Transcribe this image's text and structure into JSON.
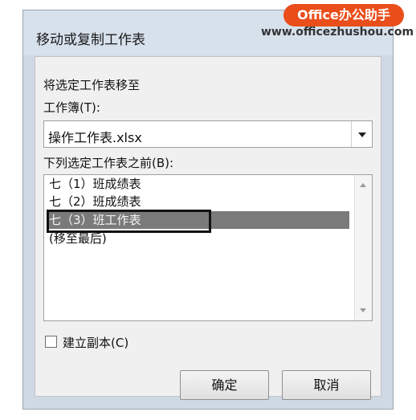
{
  "dialog": {
    "title": "移动或复制工作表",
    "move_to_label": "将选定工作表移至",
    "workbook_label": "工作簿(T):",
    "workbook_value": "操作工作表.xlsx",
    "before_sheet_label": "下列选定工作表之前(B):",
    "sheets": [
      "七（1）班成绩表",
      "七（2）班成绩表",
      "七（3）班工作表",
      "(移至最后)"
    ],
    "selected_index": 2,
    "create_copy_label": "建立副本(C)",
    "create_copy_checked": false,
    "ok_label": "确定",
    "cancel_label": "取消"
  },
  "watermark": {
    "badge": "Office办公助手",
    "url": "www.officezhushou.com"
  },
  "colors": {
    "selection": "#7a7a7a",
    "watermark_badge": "#e94e1b"
  }
}
